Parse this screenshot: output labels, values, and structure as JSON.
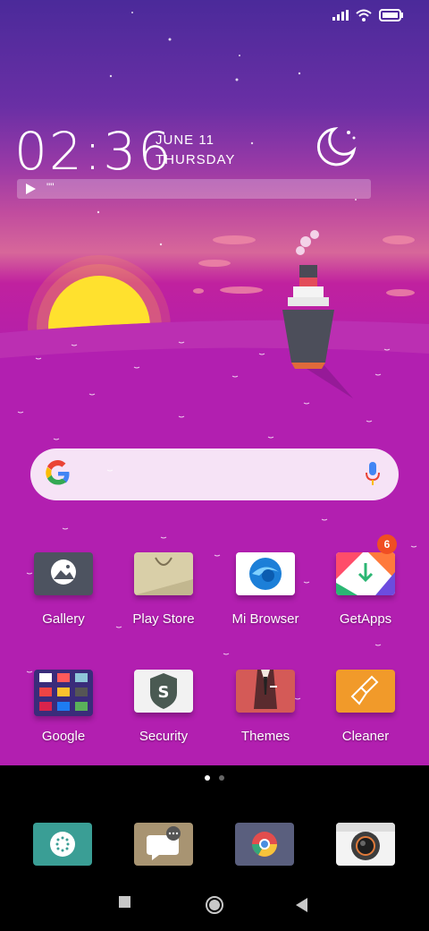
{
  "status_bar": {
    "icons": [
      "signal-icon",
      "wifi-icon",
      "battery-icon"
    ]
  },
  "clock": {
    "time": "02:36",
    "date": "JUNE 11",
    "weekday": "THURSDAY"
  },
  "music": {
    "text": "\"\""
  },
  "search": {
    "icons": [
      "google-icon",
      "mic-icon"
    ]
  },
  "apps_row1": [
    {
      "label": "Gallery",
      "icon": "gallery-icon"
    },
    {
      "label": "Play Store",
      "icon": "play-store-icon"
    },
    {
      "label": "Mi Browser",
      "icon": "mi-browser-icon"
    },
    {
      "label": "GetApps",
      "icon": "getapps-icon",
      "badge": "6"
    }
  ],
  "apps_row2": [
    {
      "label": "Google",
      "icon": "google-folder-icon"
    },
    {
      "label": "Security",
      "icon": "security-icon"
    },
    {
      "label": "Themes",
      "icon": "themes-icon"
    },
    {
      "label": "Cleaner",
      "icon": "cleaner-icon"
    }
  ],
  "page_indicator": {
    "pages": 2,
    "current": 1
  },
  "dock": [
    "phone-icon",
    "messages-icon",
    "chrome-icon",
    "camera-icon"
  ],
  "navbar": [
    "recents-button",
    "home-button",
    "back-button"
  ],
  "colors": {
    "accent_badge": "#f04e23",
    "sky_top": "#4b2a9a",
    "sea": "#b01fae"
  }
}
